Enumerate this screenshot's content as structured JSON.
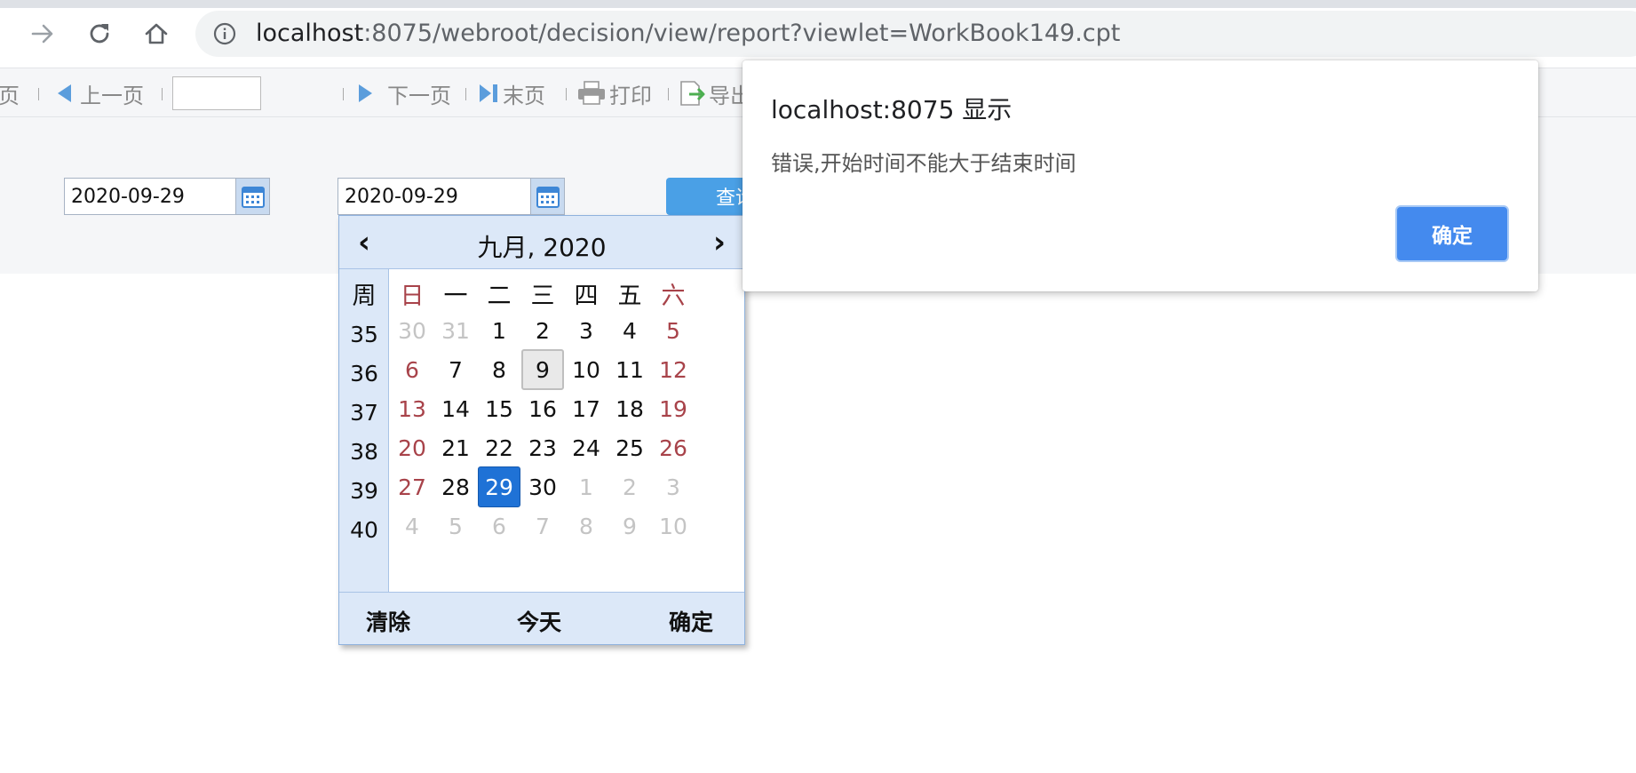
{
  "browser": {
    "url_host": "localhost",
    "url_path": ":8075/webroot/decision/view/report?viewlet=WorkBook149.cpt"
  },
  "toolbar": {
    "first_fragment": "页",
    "prev_label": "上一页",
    "next_label": "下一页",
    "last_label": "末页",
    "print_label": "打印",
    "export_label": "导出"
  },
  "params": {
    "start_date": "2020-09-29",
    "end_date": "2020-09-29",
    "query_label": "查询"
  },
  "calendar": {
    "title": "九月, 2020",
    "prev": "‹",
    "next": "›",
    "week_header": "周",
    "day_headers": [
      "日",
      "一",
      "二",
      "三",
      "四",
      "五",
      "六"
    ],
    "week_numbers": [
      "35",
      "36",
      "37",
      "38",
      "39",
      "40"
    ],
    "days": [
      [
        "30",
        "31",
        "1",
        "2",
        "3",
        "4",
        "5"
      ],
      [
        "6",
        "7",
        "8",
        "9",
        "10",
        "11",
        "12"
      ],
      [
        "13",
        "14",
        "15",
        "16",
        "17",
        "18",
        "19"
      ],
      [
        "20",
        "21",
        "22",
        "23",
        "24",
        "25",
        "26"
      ],
      [
        "27",
        "28",
        "29",
        "30",
        "1",
        "2",
        "3"
      ],
      [
        "4",
        "5",
        "6",
        "7",
        "8",
        "9",
        "10"
      ]
    ],
    "clear_label": "清除",
    "today_label": "今天",
    "ok_label": "确定",
    "colors": {
      "weekend": "#a8434a",
      "selected": "#1f72d6",
      "header_bg": "#dce8f8"
    }
  },
  "alert": {
    "title": "localhost:8075 显示",
    "message": "错误,开始时间不能大于结束时间",
    "ok_label": "确定",
    "button_color": "#448aee"
  }
}
